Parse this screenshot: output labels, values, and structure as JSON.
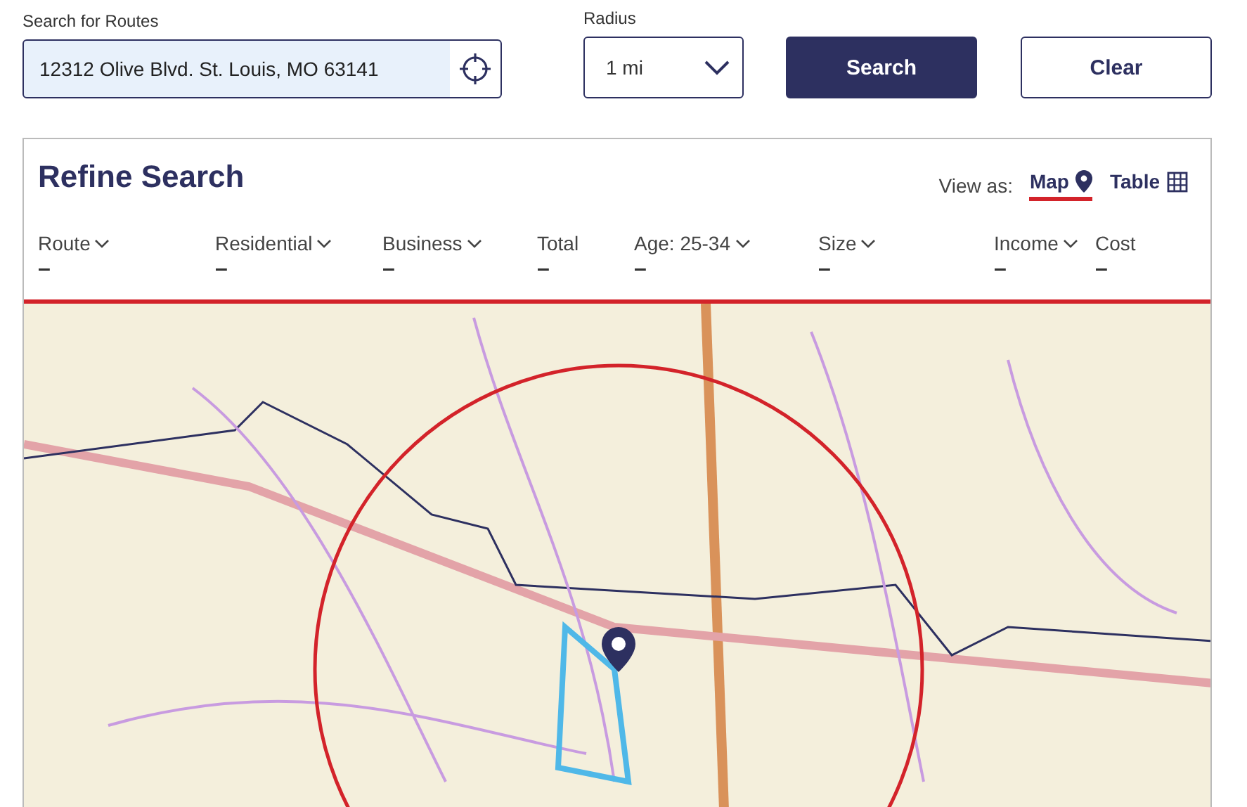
{
  "search": {
    "label": "Search for Routes",
    "value": "12312 Olive Blvd. St. Louis, MO 63141"
  },
  "radius": {
    "label": "Radius",
    "value": "1 mi"
  },
  "buttons": {
    "search": "Search",
    "clear": "Clear"
  },
  "refine": {
    "title": "Refine Search",
    "view_label": "View as:",
    "views": [
      {
        "label": "Map",
        "kind": "pin",
        "selected": true
      },
      {
        "label": "Table",
        "kind": "grid",
        "selected": false
      }
    ]
  },
  "columns": [
    {
      "label": "Route",
      "sortable": true,
      "value": "–"
    },
    {
      "label": "Residential",
      "sortable": true,
      "value": "–"
    },
    {
      "label": "Business",
      "sortable": true,
      "value": "–"
    },
    {
      "label": "Total",
      "sortable": false,
      "value": "–"
    },
    {
      "label": "Age: 25-34",
      "sortable": true,
      "value": "–"
    },
    {
      "label": "Size",
      "sortable": true,
      "value": "–"
    },
    {
      "label": "Income",
      "sortable": true,
      "value": "–"
    },
    {
      "label": "Cost",
      "sortable": false,
      "value": "–"
    }
  ]
}
